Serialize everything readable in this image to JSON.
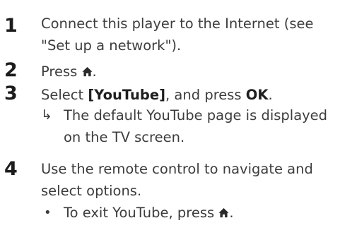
{
  "steps": [
    {
      "number": "1",
      "line1": "Connect this player to the Internet (see",
      "line2": "\"Set up a network\")."
    },
    {
      "number": "2",
      "text_before": "Press ",
      "text_after": ".",
      "icon": "home-icon"
    },
    {
      "number": "3",
      "select_word": "Select ",
      "option": "[YouTube]",
      "mid": ", and press ",
      "button": "OK",
      "end": ".",
      "result_arrow": "↳",
      "result_line1": "The default YouTube page is displayed",
      "result_line2": "on the TV screen."
    },
    {
      "number": "4",
      "line1": "Use the remote control to navigate and",
      "line2": "select options.",
      "bullet_symbol": "•",
      "bullet_text_before": "To exit YouTube, press ",
      "bullet_text_after": ".",
      "bullet_icon": "home-icon"
    }
  ],
  "colors": {
    "text": "#3c3c3c",
    "numbers": "#1c1c1c"
  }
}
